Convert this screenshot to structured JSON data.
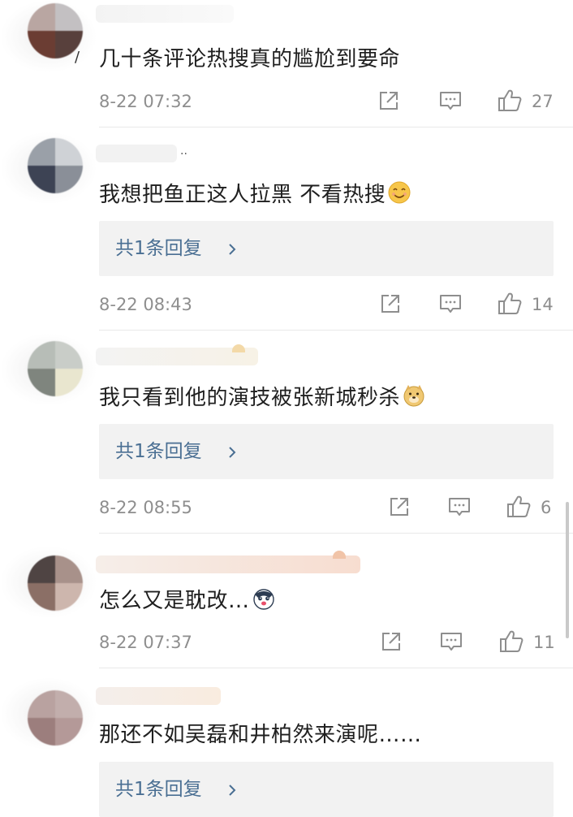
{
  "comments": [
    {
      "text": "几十条评论热搜真的尴尬到要命",
      "time": "8-22 07:32",
      "likes": "27"
    },
    {
      "text": "我想把鱼正这人拉黑 不看热搜",
      "emoji": "smile-emoji",
      "reply_label": "共1条回复",
      "time": "8-22 08:43",
      "likes": "14"
    },
    {
      "text": "我只看到他的演技被张新城秒杀",
      "emoji": "doge-emoji",
      "reply_label": "共1条回复",
      "time": "8-22 08:55",
      "likes": "6"
    },
    {
      "text": "怎么又是耽改…",
      "emoji": "husky-emoji",
      "time": "8-22 07:37",
      "likes": "11"
    },
    {
      "text": "那还不如吴磊和井柏然来演呢……",
      "reply_label": "共1条回复"
    }
  ],
  "icons": {
    "share": "share-icon",
    "comment": "comment-icon",
    "like": "thumbs-up-icon",
    "chevron": "chevron-right-icon"
  },
  "colors": {
    "reply_link": "#4a6f93",
    "meta_gray": "#8e8e8e",
    "reply_bg": "#f2f2f2"
  }
}
